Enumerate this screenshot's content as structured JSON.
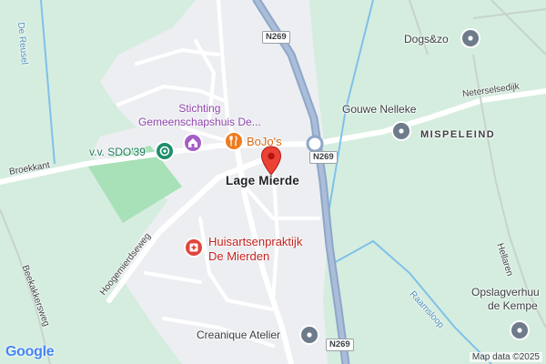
{
  "map": {
    "place_label": "Lage Mierde",
    "district_label": "MISPELEIND",
    "highway_shield": "N269",
    "pois": {
      "stichting_line1": "Stichting",
      "stichting_line2": "Gemeenschapshuis De...",
      "sdo39": "v.v. SDO'39",
      "bojos": "BoJo's",
      "huisarts_line1": "Huisartsenpraktijk",
      "huisarts_line2": "De Mierden",
      "creanique": "Creanique Atelier",
      "dogs": "Dogs&zo",
      "gouwe": "Gouwe Nelleke",
      "opslag_line1": "Opslagverhuu",
      "opslag_line2": "de Kempe"
    },
    "roads": {
      "de_reusel": "De Reusel",
      "broekkant": "Broekkant",
      "hoogemierdseweg": "Hoogemierdseweg",
      "beekakkersweg": "Beekakkersweg",
      "neterselsedijk": "Neterselsedijk",
      "hellaren": "Hellaren",
      "raamsloop": "Raamsloop"
    },
    "attribution": "Map data ©2025",
    "logo": "Google",
    "colors": {
      "land": "#d5eddf",
      "urban": "#eceef1",
      "field": "#a8e0b8",
      "highway": "#8fa6c9",
      "water": "#7fc1e8",
      "pin_red": "#ea4335"
    }
  }
}
